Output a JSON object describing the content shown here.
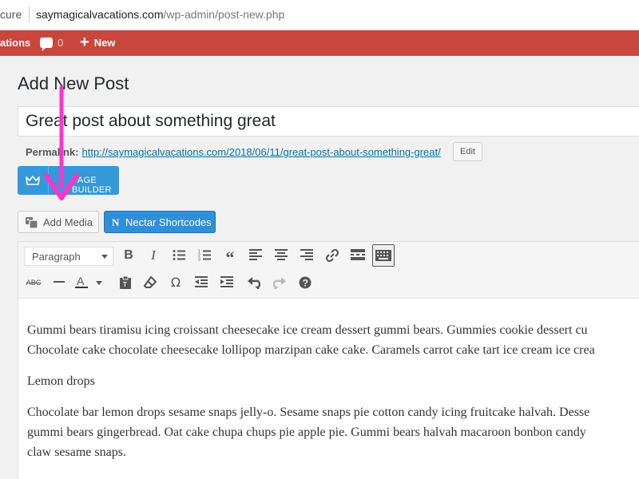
{
  "browser": {
    "secure_label": "cure",
    "url_host": "saymagicalvacations.com",
    "url_path": "/wp-admin/post-new.php"
  },
  "admin_bar": {
    "site_name": "ations",
    "comments_count": "0",
    "new_label": "New",
    "bg_color": "#c9463d"
  },
  "page": {
    "title": "Add New Post"
  },
  "post": {
    "title_value": "Great post about something great",
    "permalink_label": "Permalink:",
    "permalink_base": "http://saymagicalvacations.com/2018/06/11/",
    "permalink_slug": "great-post-about-something-great",
    "permalink_trailing": "/",
    "edit_label": "Edit"
  },
  "buttons": {
    "page_builder": "PAGE BUILDER",
    "add_media": "Add Media",
    "nectar_shortcodes": "Nectar Shortcodes"
  },
  "toolbar": {
    "format_value": "Paragraph",
    "icons_row1": [
      "bold-icon",
      "italic-icon",
      "bullet-list-icon",
      "numbered-list-icon",
      "blockquote-icon",
      "align-left-icon",
      "align-center-icon",
      "align-right-icon",
      "link-icon",
      "read-more-icon",
      "toolbar-toggle-icon"
    ],
    "icons_row2": [
      "strikethrough-icon",
      "horizontal-line-icon",
      "text-color-icon",
      "paste-text-icon",
      "clear-formatting-icon",
      "special-character-icon",
      "outdent-icon",
      "indent-icon",
      "undo-icon",
      "redo-icon",
      "help-icon"
    ]
  },
  "content": {
    "p1_line1": "Gummi bears tiramisu icing croissant cheesecake ice cream dessert gummi bears. Gummies cookie dessert cu",
    "p1_line2": "Chocolate cake chocolate cheesecake lollipop marzipan cake cake. Caramels carrot cake tart ice cream ice crea",
    "p2": "Lemon drops",
    "p3_line1": "Chocolate bar lemon drops sesame snaps jelly-o. Sesame snaps pie cotton candy icing fruitcake halvah. Desse",
    "p3_line2": "gummi bears gingerbread. Oat cake chupa chups pie apple pie. Gummi bears halvah macaroon bonbon candy",
    "p3_line3": "claw sesame snaps."
  },
  "annotation": {
    "arrow_color": "#ff33cc"
  }
}
